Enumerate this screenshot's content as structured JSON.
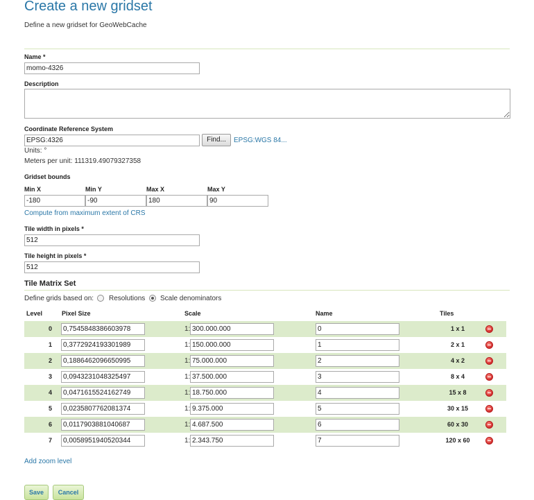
{
  "header": {
    "title": "Create a new gridset",
    "subtitle": "Define a new gridset for GeoWebCache"
  },
  "form": {
    "name_label": "Name *",
    "name_value": "momo-4326",
    "description_label": "Description",
    "description_value": "",
    "crs_label": "Coordinate Reference System",
    "crs_value": "EPSG:4326",
    "find_label": "Find...",
    "crs_link": "EPSG:WGS 84...",
    "units_text": "Units: °",
    "meters_per_unit_text": "Meters per unit: 111319.49079327358",
    "bounds_label": "Gridset bounds",
    "bounds": {
      "minx_label": "Min X",
      "minx_value": "-180",
      "miny_label": "Min Y",
      "miny_value": "-90",
      "maxx_label": "Max X",
      "maxx_value": "180",
      "maxy_label": "Max Y",
      "maxy_value": "90"
    },
    "compute_link": "Compute from maximum extent of CRS",
    "tile_width_label": "Tile width in pixels *",
    "tile_width_value": "512",
    "tile_height_label": "Tile height in pixels *",
    "tile_height_value": "512"
  },
  "matrix": {
    "title": "Tile Matrix Set",
    "define_label": "Define grids based on:",
    "resolutions_label": "Resolutions",
    "scale_label": "Scale denominators",
    "selected": "scale",
    "columns": {
      "level": "Level",
      "pixel_size": "Pixel Size",
      "scale": "Scale",
      "name": "Name",
      "tiles": "Tiles"
    },
    "scale_prefix": "1:",
    "rows": [
      {
        "level": "0",
        "pixel_size": "0,7545848386603978",
        "scale": "300.000.000",
        "name": "0",
        "tiles": "1 x 1"
      },
      {
        "level": "1",
        "pixel_size": "0,3772924193301989",
        "scale": "150.000.000",
        "name": "1",
        "tiles": "2 x 1"
      },
      {
        "level": "2",
        "pixel_size": "0,1886462096650995",
        "scale": "75.000.000",
        "name": "2",
        "tiles": "4 x 2"
      },
      {
        "level": "3",
        "pixel_size": "0,0943231048325497",
        "scale": "37.500.000",
        "name": "3",
        "tiles": "8 x 4"
      },
      {
        "level": "4",
        "pixel_size": "0,0471615524162749",
        "scale": "18.750.000",
        "name": "4",
        "tiles": "15 x 8"
      },
      {
        "level": "5",
        "pixel_size": "0,0235807762081374",
        "scale": "9.375.000",
        "name": "5",
        "tiles": "30 x 15"
      },
      {
        "level": "6",
        "pixel_size": "0,0117903881040687",
        "scale": "4.687.500",
        "name": "6",
        "tiles": "60 x 30"
      },
      {
        "level": "7",
        "pixel_size": "0,0058951940520344",
        "scale": "2.343.750",
        "name": "7",
        "tiles": "120 x 60"
      }
    ],
    "add_zoom_link": "Add zoom level"
  },
  "actions": {
    "save_label": "Save",
    "cancel_label": "Cancel"
  },
  "colors": {
    "accent": "#2a77a7",
    "row_alt": "#dcebcb",
    "remove": "#d32f2f"
  }
}
